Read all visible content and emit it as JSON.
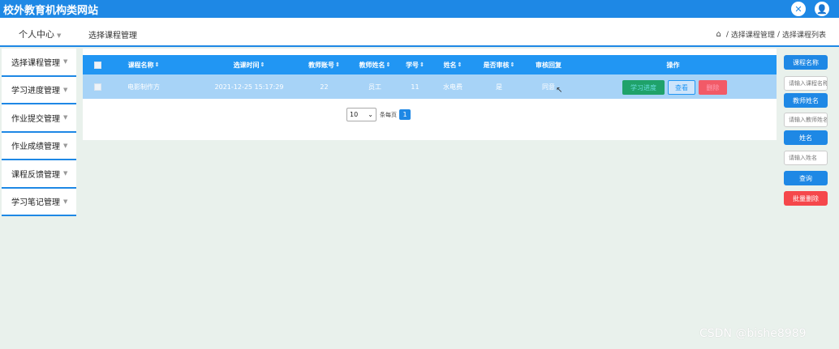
{
  "header": {
    "title": "校外教育机构类网站",
    "icons": [
      "close-x-icon",
      "user-icon"
    ]
  },
  "subbar": {
    "user_menu": "个人中心",
    "page_title": "选择课程管理",
    "breadcrumb": [
      "选择课程管理",
      "选择课程列表"
    ]
  },
  "sidebar": {
    "items": [
      {
        "label": "选择课程管理"
      },
      {
        "label": "学习进度管理"
      },
      {
        "label": "作业提交管理"
      },
      {
        "label": "作业成绩管理"
      },
      {
        "label": "课程反馈管理"
      },
      {
        "label": "学习笔记管理"
      }
    ]
  },
  "table": {
    "headers": [
      "课程名称",
      "选课时间",
      "教师账号",
      "教师姓名",
      "学号",
      "姓名",
      "是否审核",
      "审核回复",
      "操作"
    ],
    "rows": [
      {
        "course_name": "电影制作方",
        "select_time": "2021-12-25 15:17:29",
        "teacher_account": "22",
        "teacher_name": "员工",
        "student_id": "11",
        "student_name": "水电费",
        "approved": "是",
        "reply": "同意",
        "actions": [
          "学习进度",
          "查看",
          "删除"
        ]
      }
    ]
  },
  "pager": {
    "page_size": "10",
    "per_page_label": "条每页",
    "current_page": "1"
  },
  "search": {
    "course_name_button": "课程名称",
    "course_name_placeholder": "请输入课程名称",
    "teacher_name_button": "教师姓名",
    "teacher_name_placeholder": "请输入教师姓名",
    "student_name_button": "姓名",
    "student_name_placeholder": "请输入姓名",
    "query_button": "查询",
    "batch_delete_button": "批量删除"
  },
  "watermark": "CSDN @bishe8989",
  "colors": {
    "primary": "#1e88e5",
    "danger": "#f5474b",
    "row_selected": "#a7d3f7",
    "background": "#e9f1ec"
  }
}
